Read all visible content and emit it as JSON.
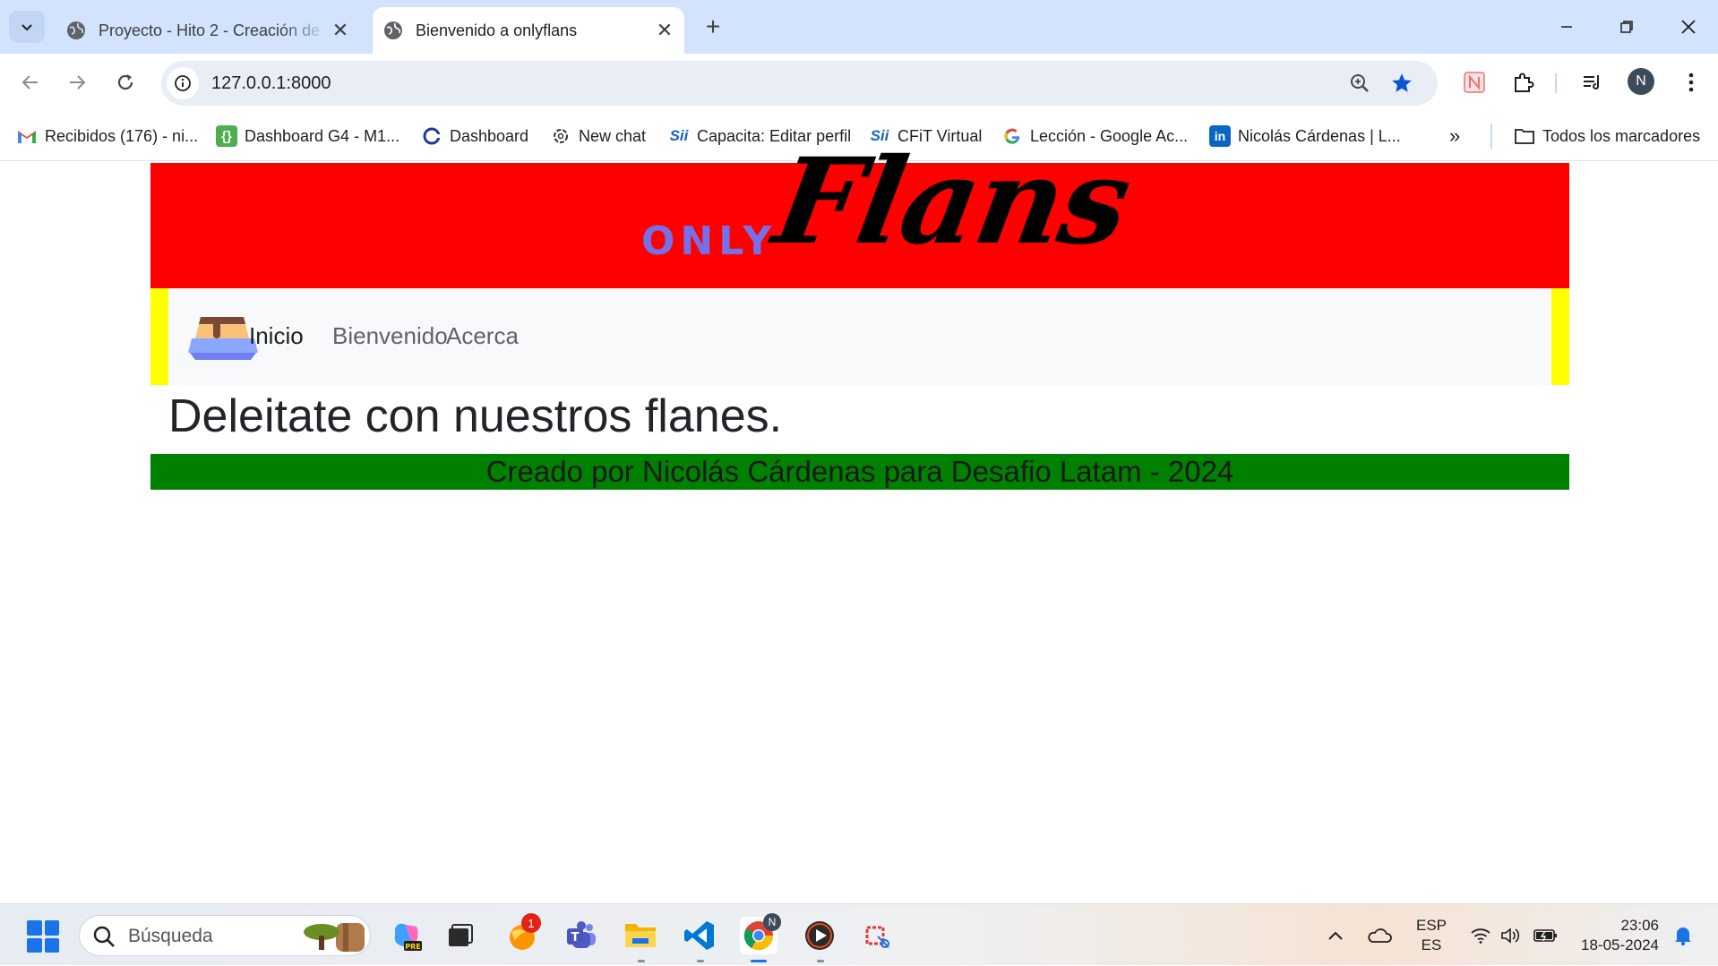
{
  "browser": {
    "tabs": [
      {
        "title": "Proyecto - Hito 2 - Creación de",
        "active": false
      },
      {
        "title": "Bienvenido a onlyflans",
        "active": true
      }
    ],
    "url": "127.0.0.1:8000",
    "profile_initial": "N",
    "bookmarks": [
      {
        "label": "Recibidos (176) - ni...",
        "icon": "gmail-icon"
      },
      {
        "label": "Dashboard G4 - M1...",
        "icon": "dashboard-icon"
      },
      {
        "label": "Dashboard",
        "icon": "coursera-icon"
      },
      {
        "label": "New chat",
        "icon": "chatgpt-icon"
      },
      {
        "label": "Capacita: Editar perfil",
        "icon": "sii-icon"
      },
      {
        "label": "CFiT Virtual",
        "icon": "sii-icon"
      },
      {
        "label": "Lección - Google Ac...",
        "icon": "google-icon"
      },
      {
        "label": "Nicolás Cárdenas | L...",
        "icon": "linkedin-icon"
      }
    ],
    "all_bookmarks_label": "Todos los marcadores"
  },
  "site": {
    "logo_small": "ONLY",
    "logo_large": "Flans",
    "nav": [
      {
        "label": "Inicio",
        "active": true
      },
      {
        "label": "Bienvenido",
        "active": false
      },
      {
        "label": "Acerca",
        "active": false
      }
    ],
    "headline": "Deleitate con nuestros flanes.",
    "footer": "Creado por Nicolás Cárdenas para Desafio Latam - 2024",
    "colors": {
      "banner": "#ff0000",
      "nav_border": "#ffff00",
      "footer": "#008000",
      "logo_accent": "#7670e8"
    }
  },
  "taskbar": {
    "search_placeholder": "Búsqueda",
    "notification_count": "1",
    "chrome_badge": "N",
    "language": "ESP",
    "language_sub": "ES",
    "time": "23:06",
    "date": "18-05-2024"
  }
}
